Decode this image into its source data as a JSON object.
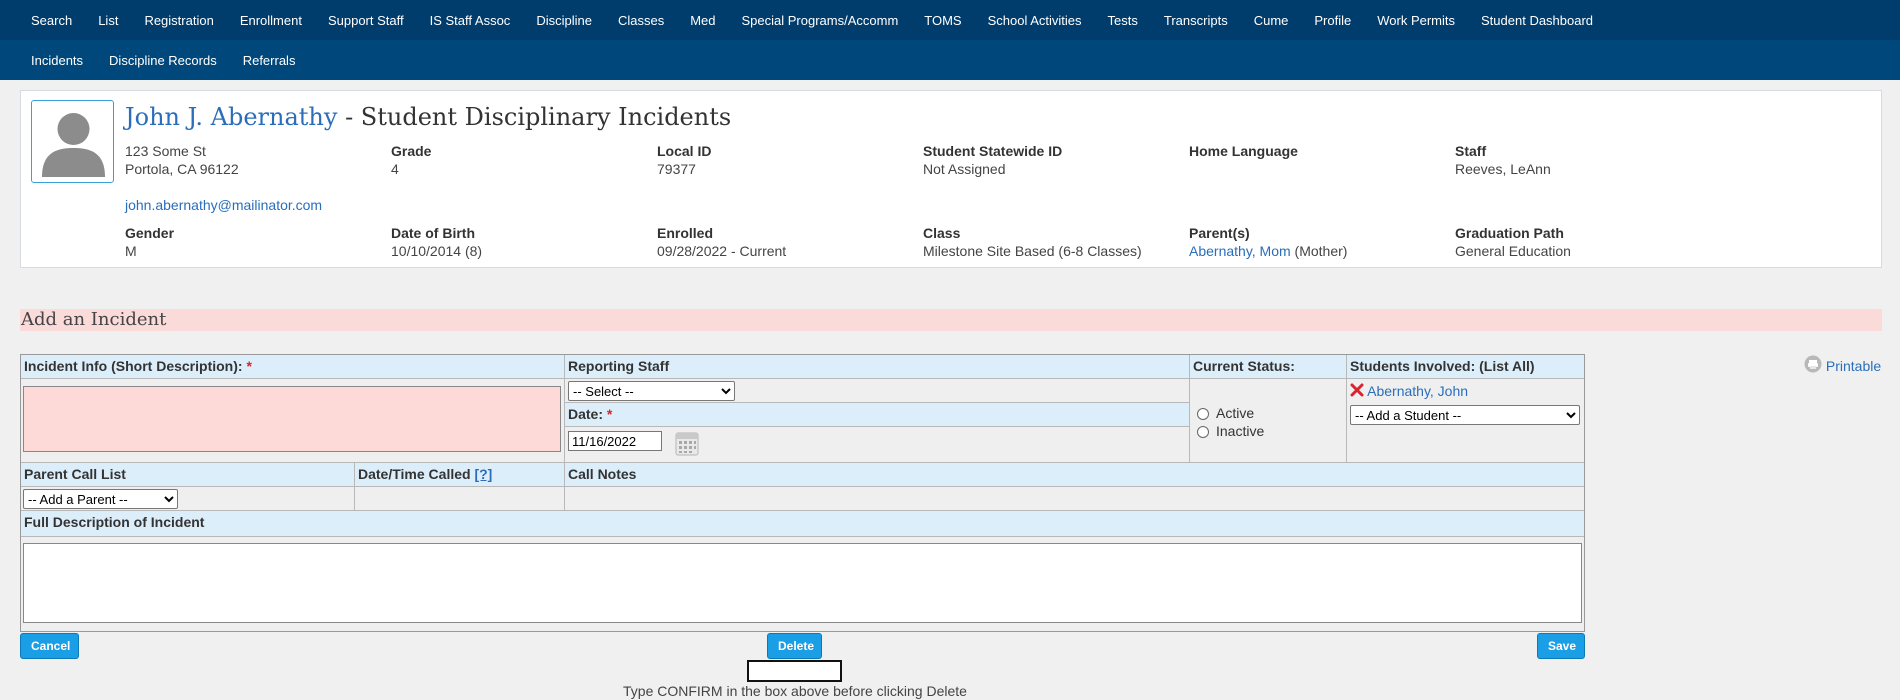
{
  "nav_primary": [
    "Search",
    "List",
    "Registration",
    "Enrollment",
    "Support Staff",
    "IS Staff Assoc",
    "Discipline",
    "Classes",
    "Med",
    "Special Programs/Accomm",
    "TOMS",
    "School Activities",
    "Tests",
    "Transcripts",
    "Cume",
    "Profile",
    "Work Permits",
    "Student Dashboard"
  ],
  "nav_secondary": [
    "Incidents",
    "Discipline Records",
    "Referrals"
  ],
  "student": {
    "name": "John J. Abernathy",
    "title_suffix": " - Student Disciplinary Incidents",
    "address_line1": "123 Some St",
    "address_line2": "Portola, CA 96122",
    "email": "john.abernathy@mailinator.com",
    "grade_label": "Grade",
    "grade": "4",
    "local_id_label": "Local ID",
    "local_id": "79377",
    "ssid_label": "Student Statewide ID",
    "ssid": "Not Assigned",
    "home_lang_label": "Home Language",
    "home_lang": "",
    "staff_label": "Staff",
    "staff": "Reeves, LeAnn",
    "gender_label": "Gender",
    "gender": "M",
    "dob_label": "Date of Birth",
    "dob": "10/10/2014 (8)",
    "enrolled_label": "Enrolled",
    "enrolled": "09/28/2022 - Current",
    "class_label": "Class",
    "class": "Milestone Site Based (6-8 Classes)",
    "parents_label": "Parent(s)",
    "parent_name": "Abernathy, Mom",
    "parent_rel": " (Mother)",
    "grad_path_label": "Graduation Path",
    "grad_path": "General Education"
  },
  "banner": "Add an Incident",
  "form": {
    "incident_info_label": "Incident Info (Short Description):",
    "required_mark": "*",
    "reporting_staff_label": "Reporting Staff",
    "reporting_staff_value": "-- Select --",
    "date_label": "Date:",
    "date_value": "11/16/2022",
    "current_status_label": "Current Status:",
    "status_active": "Active",
    "status_inactive": "Inactive",
    "students_involved_label": "Students Involved: (List All)",
    "student_involved": "Abernathy, John",
    "add_student": "-- Add a Student --",
    "parent_call_list_label": "Parent Call List",
    "add_parent": "-- Add a Parent --",
    "date_time_called_label": "Date/Time Called",
    "help_mark": "[?]",
    "call_notes_label": "Call Notes",
    "full_desc_label": "Full Description of Incident"
  },
  "printable": "Printable",
  "buttons": {
    "cancel": "Cancel",
    "delete": "Delete",
    "save": "Save"
  },
  "confirm_hint": "Type CONFIRM in the box above before clicking Delete",
  "colors": {
    "nav": "#003c6c",
    "accent": "#1a9ee6",
    "link": "#2a6ebb",
    "required": "#d9232e"
  }
}
